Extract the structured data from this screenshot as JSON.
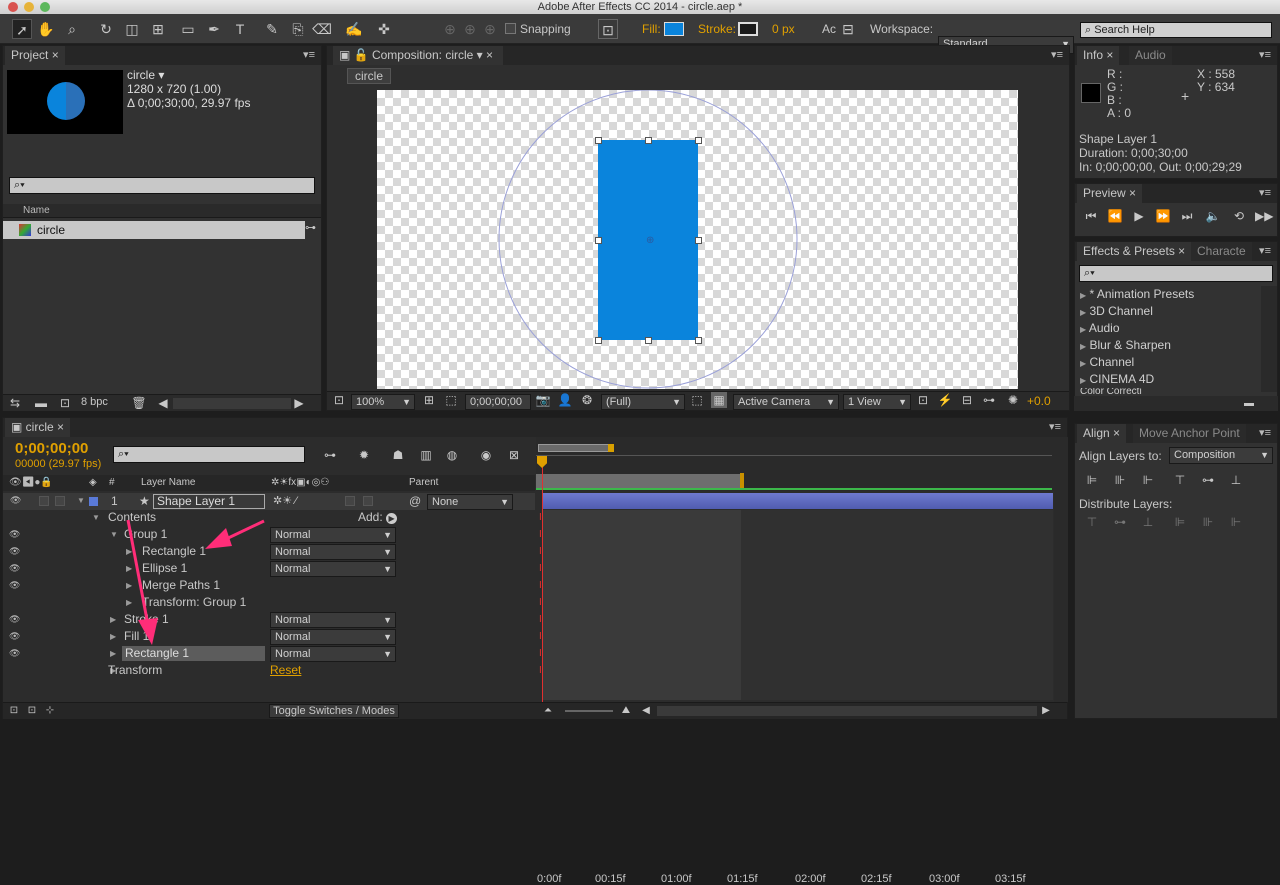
{
  "window": {
    "title": "Adobe After Effects CC 2014 - circle.aep *"
  },
  "toolbar": {
    "snapping": "Snapping",
    "fill_label": "Fill:",
    "fill_color": "#0a84dc",
    "stroke_label": "Stroke:",
    "stroke_width": "0 px",
    "workspace_label": "Workspace:",
    "workspace_value": "Standard",
    "search_help": "Search Help",
    "ac_label": "Ac"
  },
  "project": {
    "tab": "Project",
    "comp_name": "circle ▾",
    "comp_size": "1280 x 720 (1.00)",
    "comp_duration": "Δ 0;00;30;00, 29.97 fps",
    "col_name": "Name",
    "items": [
      {
        "name": "circle"
      }
    ],
    "bpc": "8 bpc"
  },
  "composition": {
    "tab": "Composition: circle",
    "crumb": "circle",
    "zoom": "100%",
    "timecode": "0;00;00;00",
    "resolution": "(Full)",
    "camera": "Active Camera",
    "views": "1 View",
    "exposure": "+0.0",
    "shape_color": "#0a84dc"
  },
  "info": {
    "tab": "Info",
    "tab2": "Audio",
    "r": "R :",
    "g": "G :",
    "b": "B :",
    "a": "A : 0",
    "x": "X : 558",
    "y": "Y : 634",
    "layer": "Shape Layer 1",
    "duration": "Duration: 0;00;30;00",
    "inout": "In: 0;00;00;00, Out: 0;00;29;29"
  },
  "preview": {
    "tab": "Preview"
  },
  "effects": {
    "tab": "Effects & Presets",
    "tab2": "Characte",
    "items": [
      "* Animation Presets",
      "3D Channel",
      "Audio",
      "Blur & Sharpen",
      "Channel",
      "CINEMA 4D",
      "Color Correcti"
    ]
  },
  "align": {
    "tab": "Align",
    "tab2": "Move Anchor Point",
    "align_to_label": "Align Layers to:",
    "align_to_value": "Composition",
    "distribute_label": "Distribute Layers:"
  },
  "timeline": {
    "tab": "circle",
    "timecode": "0;00;00;00",
    "fps": "00000 (29.97 fps)",
    "col_hash": "#",
    "col_layer_name": "Layer Name",
    "col_parent": "Parent",
    "layer_num": "1",
    "layer_name": "Shape Layer 1",
    "parent_value": "None",
    "add_label": "Add:",
    "reset_label": "Reset",
    "toggle_label": "Toggle Switches / Modes",
    "ruler": [
      "0:00f",
      "00:15f",
      "01:00f",
      "01:15f",
      "02:00f",
      "02:15f",
      "03:00f",
      "03:15f"
    ],
    "rows": [
      {
        "label": "Contents",
        "mode": ""
      },
      {
        "label": "Group 1",
        "mode": "Normal"
      },
      {
        "label": "Rectangle 1",
        "mode": "Normal"
      },
      {
        "label": "Ellipse 1",
        "mode": "Normal"
      },
      {
        "label": "Merge Paths 1",
        "mode": ""
      },
      {
        "label": "Transform: Group 1",
        "mode": ""
      },
      {
        "label": "Stroke 1",
        "mode": "Normal"
      },
      {
        "label": "Fill 1",
        "mode": "Normal"
      },
      {
        "label": "Rectangle 1",
        "mode": "Normal"
      },
      {
        "label": "Transform",
        "mode": ""
      }
    ],
    "annotation_color": "#ff2d78"
  }
}
